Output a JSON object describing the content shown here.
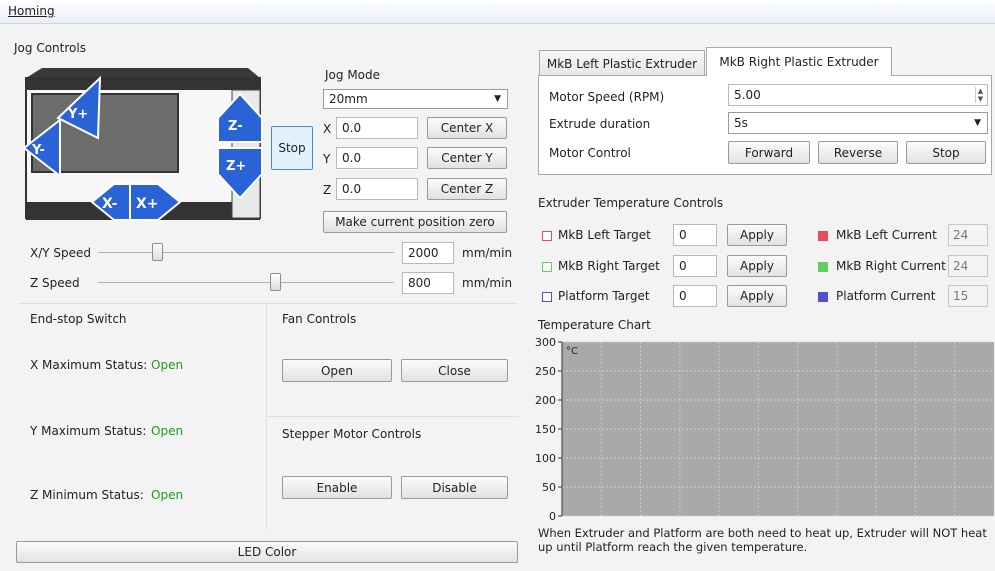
{
  "menubar": {
    "homing": "Homing"
  },
  "jog": {
    "title": "Jog Controls",
    "mode_label": "Jog Mode",
    "mode_value": "20mm",
    "stop_label": "Stop",
    "axes": [
      {
        "axis": "X",
        "value": "0.0",
        "center_label": "Center X"
      },
      {
        "axis": "Y",
        "value": "0.0",
        "center_label": "Center Y"
      },
      {
        "axis": "Z",
        "value": "0.0",
        "center_label": "Center Z"
      }
    ],
    "zero_label": "Make current position zero",
    "arrows": {
      "y_minus": "Y-",
      "y_plus": "Y+",
      "x_minus": "X-",
      "x_plus": "X+",
      "z_minus": "Z-",
      "z_plus": "Z+"
    },
    "xy_speed": {
      "label": "X/Y Speed",
      "value": "2000",
      "unit": "mm/min",
      "level": 0.2
    },
    "z_speed": {
      "label": "Z Speed",
      "value": "800",
      "unit": "mm/min",
      "level": 0.6
    }
  },
  "endstop": {
    "title": "End-stop Switch",
    "items": [
      {
        "label": "X Maximum Status:",
        "value": "Open"
      },
      {
        "label": "Y Maximum Status:",
        "value": "Open"
      },
      {
        "label": "Z Minimum Status:",
        "value": "Open"
      }
    ]
  },
  "fan": {
    "title": "Fan Controls",
    "open_label": "Open",
    "close_label": "Close"
  },
  "stepper": {
    "title": "Stepper Motor Controls",
    "enable_label": "Enable",
    "disable_label": "Disable"
  },
  "led": {
    "label": "LED Color"
  },
  "extruder_tabs": {
    "tabs": [
      "MkB Left Plastic Extruder",
      "MkB Right Plastic Extruder"
    ],
    "active": 1,
    "motor_speed_label": "Motor Speed (RPM)",
    "motor_speed_value": "5.00",
    "extrude_duration_label": "Extrude duration",
    "extrude_duration_value": "5s",
    "motor_control_label": "Motor Control",
    "forward_label": "Forward",
    "reverse_label": "Reverse",
    "stop_label": "Stop"
  },
  "temperature": {
    "title": "Extruder Temperature Controls",
    "rows": [
      {
        "target_label": "MkB Left Target",
        "target_value": "0",
        "apply_label": "Apply",
        "current_label": "MkB Left Current",
        "current_value": "24",
        "color": "#e64b5f"
      },
      {
        "target_label": "MkB Right Target",
        "target_value": "0",
        "apply_label": "Apply",
        "current_label": "MkB Right Current",
        "current_value": "24",
        "color": "#5fcf5f"
      },
      {
        "target_label": "Platform Target",
        "target_value": "0",
        "apply_label": "Apply",
        "current_label": "Platform Current",
        "current_value": "15",
        "color": "#5050c8"
      }
    ]
  },
  "chart": {
    "title": "Temperature Chart",
    "unit": "°C",
    "ticks": [
      "300",
      "250",
      "200",
      "150",
      "100",
      "50",
      "0"
    ],
    "note": "When Extruder and Platform are both need to heat up, Extruder will NOT heat up until Platform reach the given temperature."
  },
  "chart_data": {
    "type": "line",
    "title": "Temperature Chart",
    "ylabel": "°C",
    "ylim": [
      0,
      300
    ],
    "yticks": [
      0,
      50,
      100,
      150,
      200,
      250,
      300
    ],
    "grid": true,
    "series": []
  },
  "colors": {
    "accent": "#2a63d6",
    "status_ok": "#1e9a1e",
    "chart_bg": "#a9a9a9"
  }
}
